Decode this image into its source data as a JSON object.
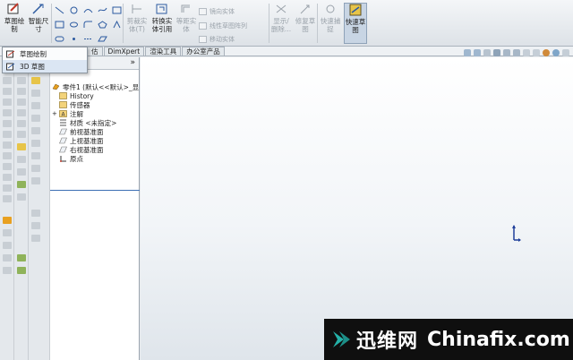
{
  "ribbon": {
    "sketch_draw": "草图绘\n制",
    "smart_dim": "智能尺\n寸",
    "trim_entities": "剪裁实\n体(T)",
    "convert_entities": "转换实\n体引用",
    "offset_entities": "等距实\n体",
    "mirror_entities": "镜向实体",
    "linear_pattern": "线性草图阵列",
    "move_entities": "移动实体",
    "display_delete": "显示/\n删除...",
    "repair_sketch": "修复草\n图",
    "quick_snap": "快速捕\n捉",
    "quick_sketch": "快速草\n图"
  },
  "tabs": [
    "估",
    "DimXpert",
    "渲染工具",
    "办公室产品"
  ],
  "dropdown": [
    {
      "label": "草图绘制"
    },
    {
      "label": "3D 草图"
    }
  ],
  "tree": {
    "root": "零件1 (默认<<默认>_显",
    "items": [
      "History",
      "传感器",
      "注解",
      "材质 <未指定>",
      "前视基准面",
      "上视基准面",
      "右视基准面",
      "原点"
    ]
  },
  "panel_more": "»",
  "watermark": {
    "cn": "迅维网",
    "en": "Chinafix.com"
  },
  "colors": {
    "accent": "#3d6fb4",
    "watermark_bg": "#0f0f0f",
    "logo": "#24b1a8"
  }
}
